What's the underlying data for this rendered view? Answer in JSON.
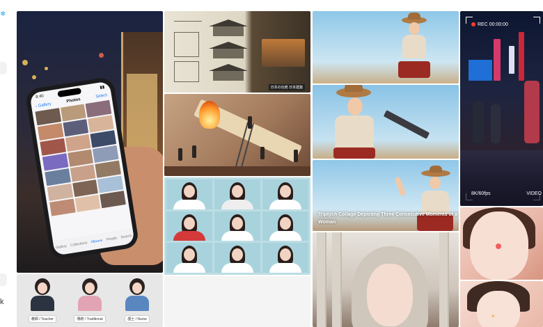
{
  "sidebar_edge": {
    "top_icon": "snowflake-icon",
    "bottom_letter": "k"
  },
  "gallery": {
    "phone_tile": {
      "status_time": "9:40",
      "nav_back": "Gallery",
      "nav_title": "Photos",
      "nav_select": "Select",
      "tabs": [
        "Gallery",
        "Collections",
        "Albums",
        "People",
        "Search"
      ]
    },
    "architecture_tile": {
      "caption": "日本の伝統 日本建築"
    },
    "cowgirl_tile": {
      "caption": "Triptych Collage Depicting Three Consecutive Moments of a Woman"
    },
    "cyberpunk_tile": {
      "rec_label": "REC 00:00:00",
      "resolution_label": "8K/60fps",
      "type_label": "VIDEO"
    },
    "sticker_tile": {
      "stickers": [
        {
          "label": "教師 / Teacher"
        },
        {
          "label": "傳統 / Traditional"
        },
        {
          "label": "護士 / Nurse"
        }
      ]
    }
  },
  "colors": {
    "accent_blue": "#1b7cf5",
    "rec_red": "#ff3b30",
    "sky_blue": "#8ec7e8"
  }
}
